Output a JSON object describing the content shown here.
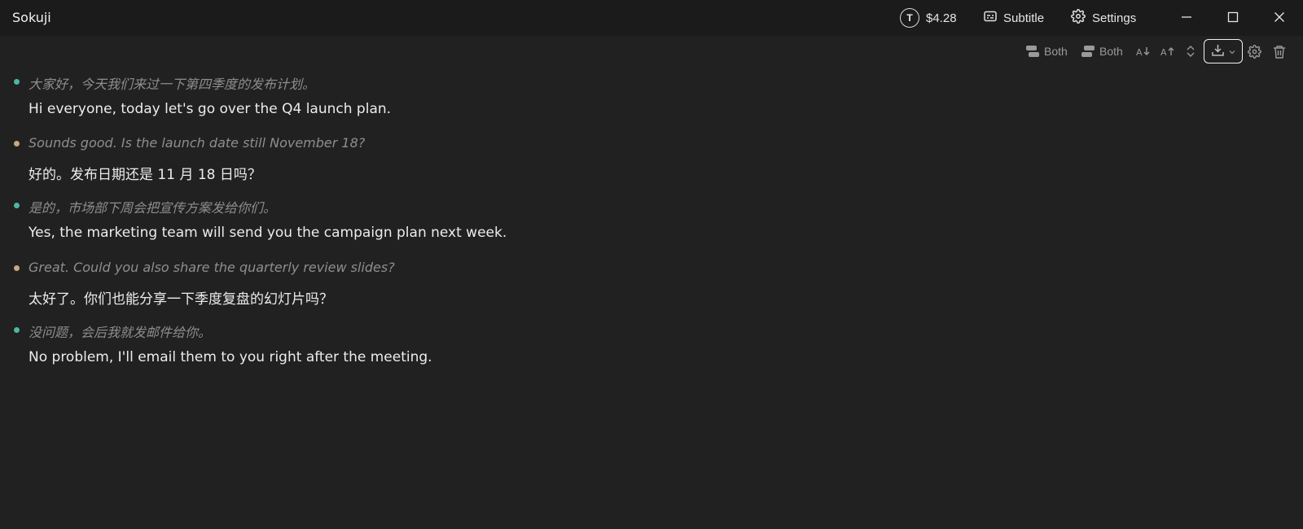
{
  "app": {
    "title": "Sokuji"
  },
  "titlebar": {
    "token_symbol": "T",
    "balance": "$4.28",
    "subtitle_label": "Subtitle",
    "settings_label": "Settings"
  },
  "toolbar": {
    "source_mode_label": "Both",
    "target_mode_label": "Both"
  },
  "colors": {
    "speaker_a": "#4db6a5",
    "speaker_b": "#c8a97e"
  },
  "conversation": [
    {
      "speaker": "a",
      "source": "大家好，今天我们来过一下第四季度的发布计划。",
      "translation": "Hi everyone, today let's go over the Q4 launch plan."
    },
    {
      "speaker": "b",
      "source": "Sounds good. Is the launch date still November 18?",
      "translation": "好的。发布日期还是 11 月 18 日吗？"
    },
    {
      "speaker": "a",
      "source": "是的，市场部下周会把宣传方案发给你们。",
      "translation": "Yes, the marketing team will send you the campaign plan next week."
    },
    {
      "speaker": "b",
      "source": "Great. Could you also share the quarterly review slides?",
      "translation": "太好了。你们也能分享一下季度复盘的幻灯片吗？"
    },
    {
      "speaker": "a",
      "source": "没问题，会后我就发邮件给你。",
      "translation": "No problem, I'll email them to you right after the meeting."
    }
  ]
}
